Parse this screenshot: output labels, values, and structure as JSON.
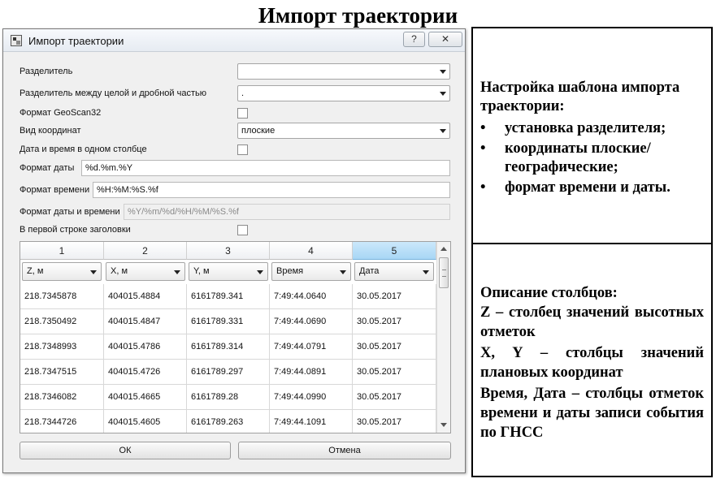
{
  "slide_title": "Импорт траектории",
  "dialog": {
    "title": "Импорт траектории",
    "help_label": "?",
    "close_label": "✕",
    "fields": {
      "separator_label": "Разделитель",
      "separator_value": "",
      "decimal_separator_label": "Разделитель между целой и дробной частью",
      "decimal_separator_value": ".",
      "geoscan_label": "Формат GeoScan32",
      "coord_type_label": "Вид координат",
      "coord_type_value": "плоские",
      "datetime_one_col_label": "Дата и время в одном столбце",
      "date_format_label": "Формат даты",
      "date_format_value": "%d.%m.%Y",
      "time_format_label": "Формат времени",
      "time_format_value": "%H:%M:%S.%f",
      "datetime_format_label": "Формат даты и времени",
      "datetime_format_value": "%Y/%m/%d/%H/%M/%S.%f",
      "header_first_row_label": "В первой строке заголовки"
    },
    "table": {
      "column_numbers": [
        "1",
        "2",
        "3",
        "4",
        "5"
      ],
      "column_types": [
        "Z, м",
        "X, м",
        "Y, м",
        "Время",
        "Дата"
      ],
      "rows": [
        [
          "218.7345878",
          "404015.4884",
          "6161789.341",
          "7:49:44.0640",
          "30.05.2017"
        ],
        [
          "218.7350492",
          "404015.4847",
          "6161789.331",
          "7:49:44.0690",
          "30.05.2017"
        ],
        [
          "218.7348993",
          "404015.4786",
          "6161789.314",
          "7:49:44.0791",
          "30.05.2017"
        ],
        [
          "218.7347515",
          "404015.4726",
          "6161789.297",
          "7:49:44.0891",
          "30.05.2017"
        ],
        [
          "218.7346082",
          "404015.4665",
          "6161789.28",
          "7:49:44.0990",
          "30.05.2017"
        ],
        [
          "218.7344726",
          "404015.4605",
          "6161789.263",
          "7:49:44.1091",
          "30.05.2017"
        ]
      ]
    },
    "ok_label": "ОК",
    "cancel_label": "Отмена"
  },
  "panel1": {
    "heading": "Настройка шаблона импорта траектории:",
    "bullet_char": "•",
    "bullets": [
      "установка разделителя;",
      "координаты плоские/географические;",
      "формат времени и даты."
    ]
  },
  "panel2": {
    "lines": [
      "Описание столбцов:",
      "Z – столбец значений высотных отметок",
      "X, Y – столбцы значений плановых координат",
      "Время, Дата – столбцы отметок времени и даты записи события по ГНСС"
    ]
  }
}
